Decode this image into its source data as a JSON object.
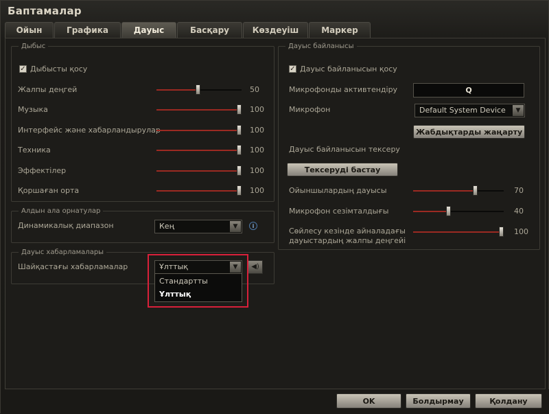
{
  "window": {
    "title": "Баптамалар"
  },
  "tabs": [
    "Ойын",
    "Графика",
    "Дауыс",
    "Басқару",
    "Көздеуіш",
    "Маркер"
  ],
  "sound": {
    "legend": "Дыбыс",
    "enable_label": "Дыбысты қосу",
    "enabled": true,
    "sliders": [
      {
        "label": "Жалпы деңгей",
        "value": 50
      },
      {
        "label": "Музыка",
        "value": 100
      },
      {
        "label": "Интерфейс және хабарландырулар",
        "value": 100
      },
      {
        "label": "Техника",
        "value": 100
      },
      {
        "label": "Эффектілер",
        "value": 100
      },
      {
        "label": "Қоршаған орта",
        "value": 100
      }
    ]
  },
  "presets": {
    "legend": "Алдын ала орнатулар",
    "dynamic_range_label": "Динамикалық диапазон",
    "dynamic_range_value": "Кең",
    "info_glyph": "i"
  },
  "voice_messages": {
    "legend": "Дауыс хабарламалары",
    "battle_messages_label": "Шайқастағы хабарламалар",
    "selected": "Ұлттық",
    "options": [
      "Стандартты",
      "Ұлттық"
    ]
  },
  "voice_chat": {
    "legend": "Дауыс байланысы",
    "enable_label": "Дауыс байланысын қосу",
    "enabled": true,
    "activate_mic_label": "Микрофонды активтендіру",
    "activate_key": "Q",
    "mic_label": "Микрофон",
    "mic_device": "Default System Device",
    "refresh_devices_label": "Жабдықтарды жаңарту",
    "test_label": "Дауыс байланысын тексеру",
    "start_test_label": "Тексеруді бастау",
    "sliders": [
      {
        "label": "Ойыншылардың дауысы",
        "value": 70
      },
      {
        "label": "Микрофон сезімталдығы",
        "value": 40
      },
      {
        "label_line1": "Сөйлесу кезінде айналадағы",
        "label_line2": "дауыстардың жалпы деңгейі",
        "value": 100
      }
    ]
  },
  "footer": {
    "ok": "OK",
    "cancel": "Болдырмау",
    "apply": "Қолдану"
  },
  "glyphs": {
    "check": "✓",
    "arrow_down": "▼",
    "speaker": "◀)"
  },
  "colors": {
    "highlight": "#d9203a",
    "slider_fill": "#9c2a22"
  }
}
